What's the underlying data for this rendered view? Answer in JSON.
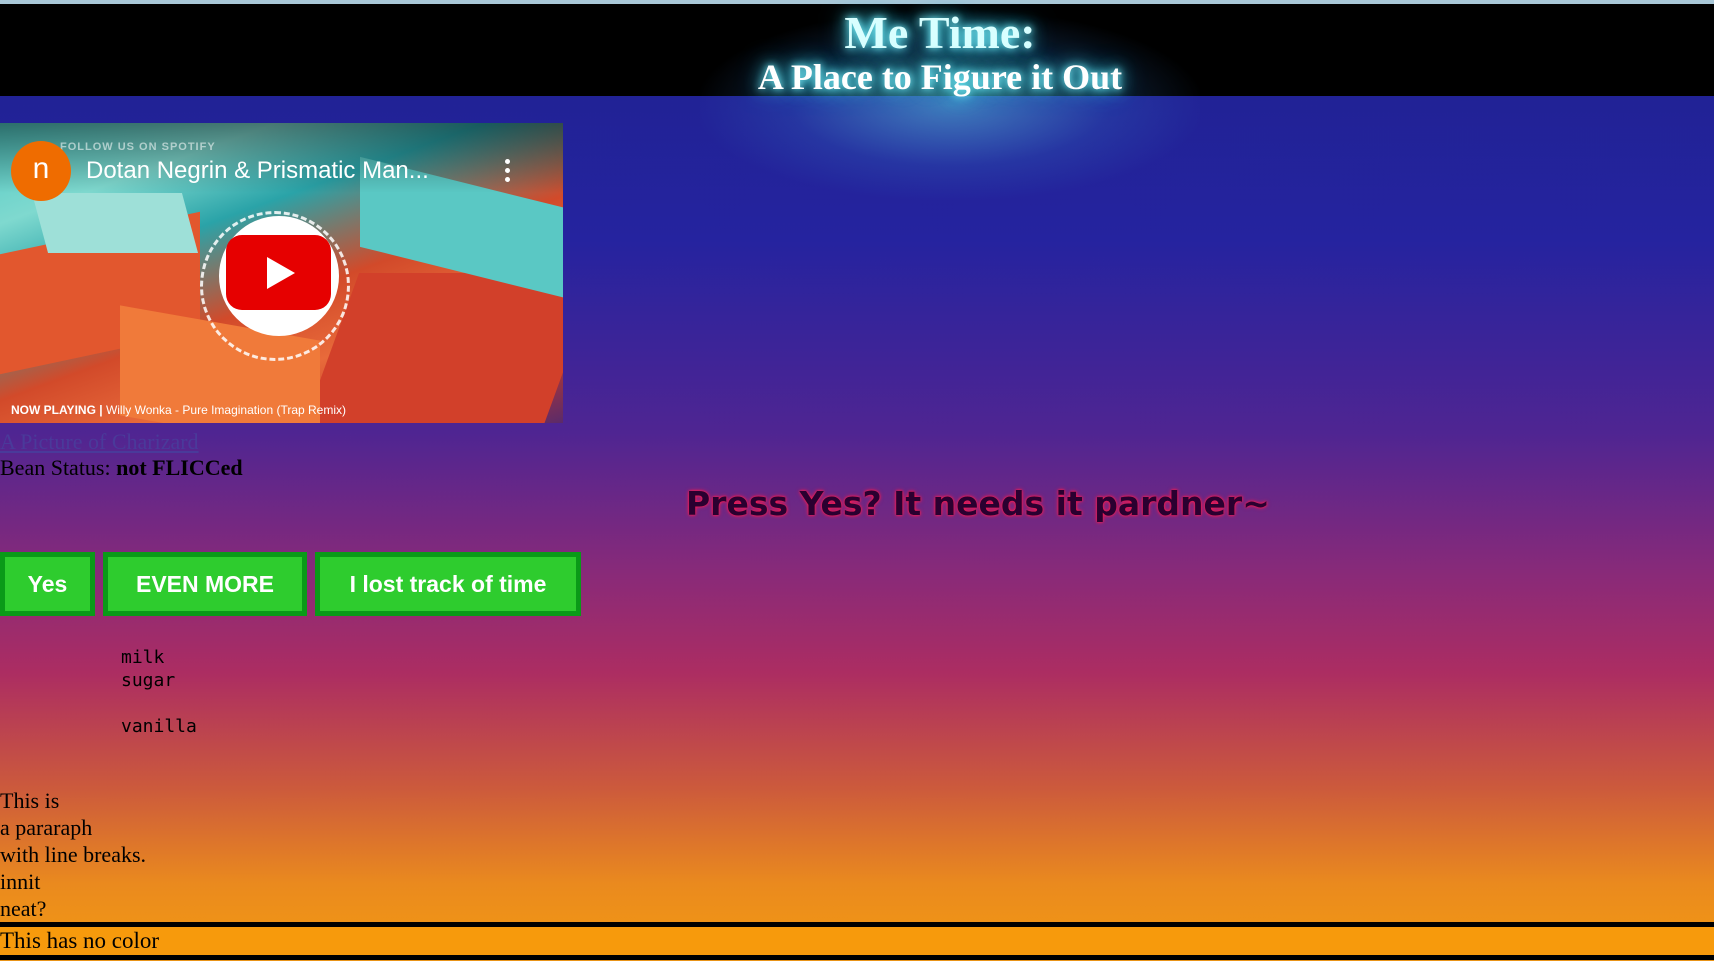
{
  "header": {
    "title": "Me Time:",
    "subtitle": "A Place to Figure it Out"
  },
  "video": {
    "channel_initial": "n",
    "title": "Dotan Negrin & Prismatic Man...",
    "spotify_text": "FOLLOW US ON SPOTIFY",
    "now_playing_label": "NOW PLAYING |",
    "now_playing_track": "Willy Wonka - Pure Imagination (Trap Remix)"
  },
  "link": {
    "text": "A Picture of Charizard"
  },
  "bean": {
    "label": "Bean Status:",
    "value": "not FLICCed"
  },
  "prompt": "Press Yes? It needs it pardner~",
  "buttons": {
    "yes": "Yes",
    "even_more": "EVEN MORE",
    "lost_track": "I lost track of time"
  },
  "list": {
    "items": [
      "milk",
      "sugar",
      "",
      "vanilla"
    ]
  },
  "paragraph": {
    "lines": [
      "This is",
      "a pararaph",
      "with line breaks.",
      "innit",
      "neat?"
    ]
  },
  "footer": {
    "text": "This has no color"
  },
  "colors": {
    "button_green": "#2ecc2e",
    "button_border": "#0a9a18",
    "footer_orange": "#f79a0c",
    "youtube_red": "#e60000"
  }
}
